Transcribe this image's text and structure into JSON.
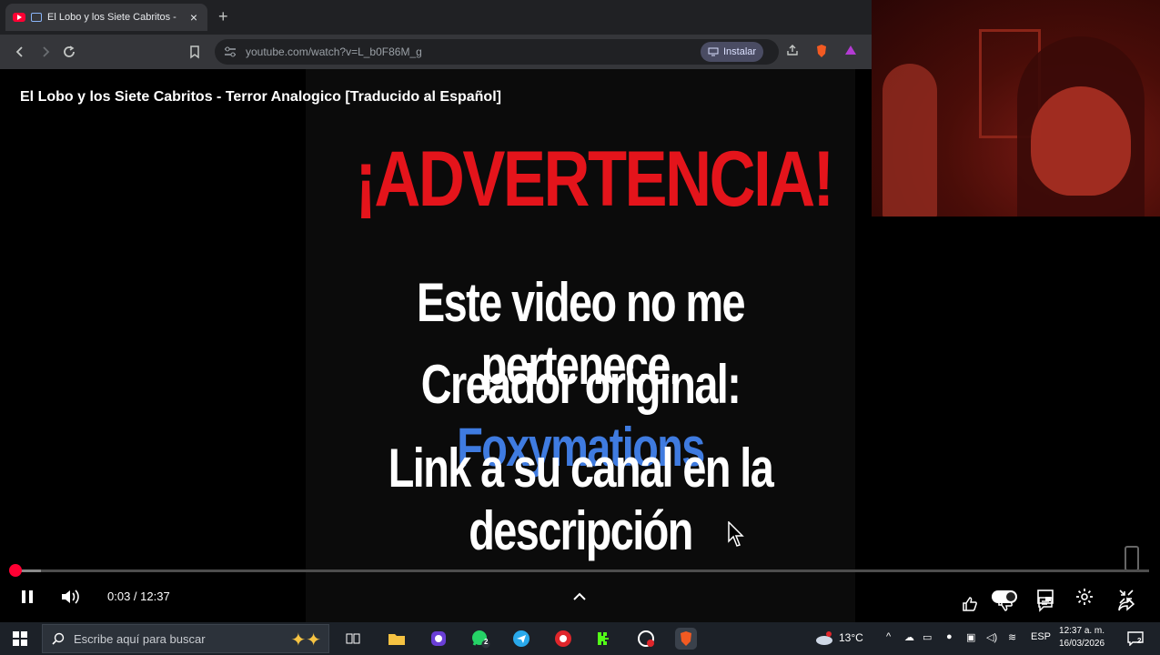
{
  "browser": {
    "tab_title": "El Lobo y los Siete Cabritos -",
    "new_tab_label": "+",
    "close_label": "×",
    "url": "youtube.com/watch?v=L_b0F86M_g",
    "install_label": "Instalar"
  },
  "video": {
    "title": "El Lobo y los Siete Cabritos - Terror Analogico [Traducido al Español]",
    "warning_title": "¡ADVERTENCIA!",
    "line1": "Este video no me pertenece.",
    "line2_prefix": "Creador original: ",
    "line2_creator": "Foxymations",
    "line3": "Link a su canal en la descripción",
    "creator_color": "#3f7be0",
    "warning_color": "#e4141b"
  },
  "player": {
    "time": "0:03 / 12:37",
    "progress_fraction": 0.004,
    "buffered_fraction": 0.026,
    "progress_color": "#ff0033"
  },
  "taskbar": {
    "search_placeholder": "Escribe aquí para buscar",
    "whatsapp_badge": "2",
    "weather": "13°C",
    "language": "ESP",
    "clock_time": "12:37 a. m.",
    "clock_date": "16/03/2026",
    "notification_badge": "2"
  },
  "icons": {
    "like": "thumbs-up-icon",
    "dislike": "thumbs-down-icon",
    "comments": "comment-icon",
    "share": "share-icon",
    "pause": "pause-icon",
    "volume": "volume-icon",
    "settings": "gear-icon",
    "fullscreen": "exit-fullscreen-icon"
  }
}
